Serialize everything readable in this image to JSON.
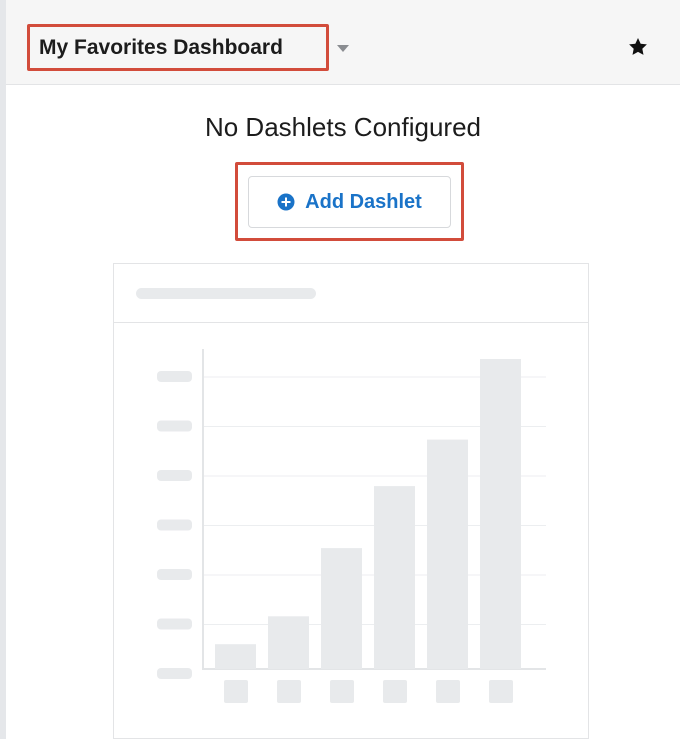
{
  "header": {
    "dashboard_title": "My Favorites Dashboard",
    "dropdown_icon": "caret-down-icon",
    "favorite_icon": "star-icon"
  },
  "main": {
    "empty_message": "No Dashlets Configured",
    "add_button_label": "Add Dashlet",
    "add_button_icon": "plus-circle-icon"
  },
  "placeholder_chart": {
    "icon": "bar-chart-placeholder",
    "bar_levels": [
      0.08,
      0.17,
      0.39,
      0.59,
      0.74,
      1.0
    ]
  },
  "colors": {
    "highlight": "#d24c3b",
    "accent": "#1a73c8",
    "placeholder": "#e8eaec"
  }
}
